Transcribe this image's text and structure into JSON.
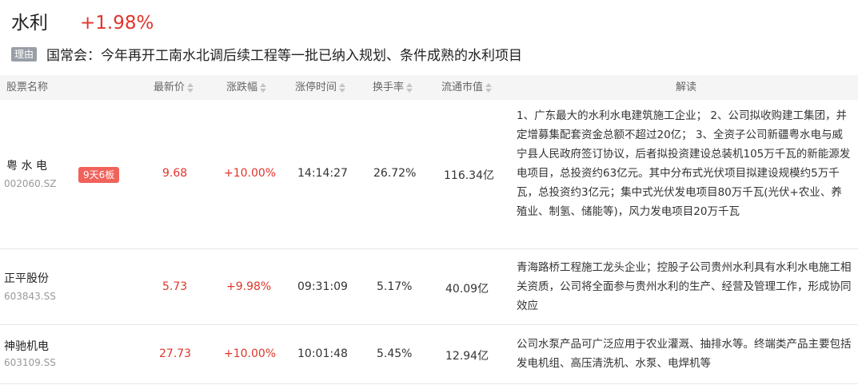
{
  "sector": {
    "name": "水利",
    "change": "+1.98%"
  },
  "reason": {
    "tag": "理由",
    "text": "国常会：今年再开工南水北调后续工程等一批已纳入规划、条件成熟的水利项目"
  },
  "columns": {
    "name": "股票名称",
    "price": "最新价",
    "change": "涨跌幅",
    "limit_time": "涨停时间",
    "turnover": "换手率",
    "market_cap": "流通市值",
    "analysis": "解读"
  },
  "rows": [
    {
      "name": "粤 水 电",
      "code": "002060.SZ",
      "badge": "9天6板",
      "price": "9.68",
      "change": "+10.00%",
      "limit_time": "14:14:27",
      "turnover": "26.72%",
      "market_cap": "116.34亿",
      "analysis": "1、广东最大的水利水电建筑施工企业； 2、公司拟收购建工集团，并定增募集配套资金总额不超过20亿； 3、全资子公司新疆粤水电与威宁县人民政府签订协议，后者拟投资建设总装机105万千瓦的新能源发电项目，总投资约63亿元。其中分布式光伏项目拟建设规模约5万千瓦，总投资约3亿元；集中式光伏发电项目80万千瓦(光伏+农业、养殖业、制氢、储能等)，风力发电项目20万千瓦"
    },
    {
      "name": "正平股份",
      "code": "603843.SS",
      "badge": "",
      "price": "5.73",
      "change": "+9.98%",
      "limit_time": "09:31:09",
      "turnover": "5.17%",
      "market_cap": "40.09亿",
      "analysis": "青海路桥工程施工龙头企业；控股子公司贵州水利具有水利水电施工相关资质，公司将全面参与贵州水利的生产、经营及管理工作，形成协同效应"
    },
    {
      "name": "神驰机电",
      "code": "603109.SS",
      "badge": "",
      "price": "27.73",
      "change": "+10.00%",
      "limit_time": "10:01:48",
      "turnover": "5.45%",
      "market_cap": "12.94亿",
      "analysis": "公司水泵产品可广泛应用于农业灌溉、抽排水等。终端类产品主要包括发电机组、高压清洗机、水泵、电焊机等"
    }
  ]
}
